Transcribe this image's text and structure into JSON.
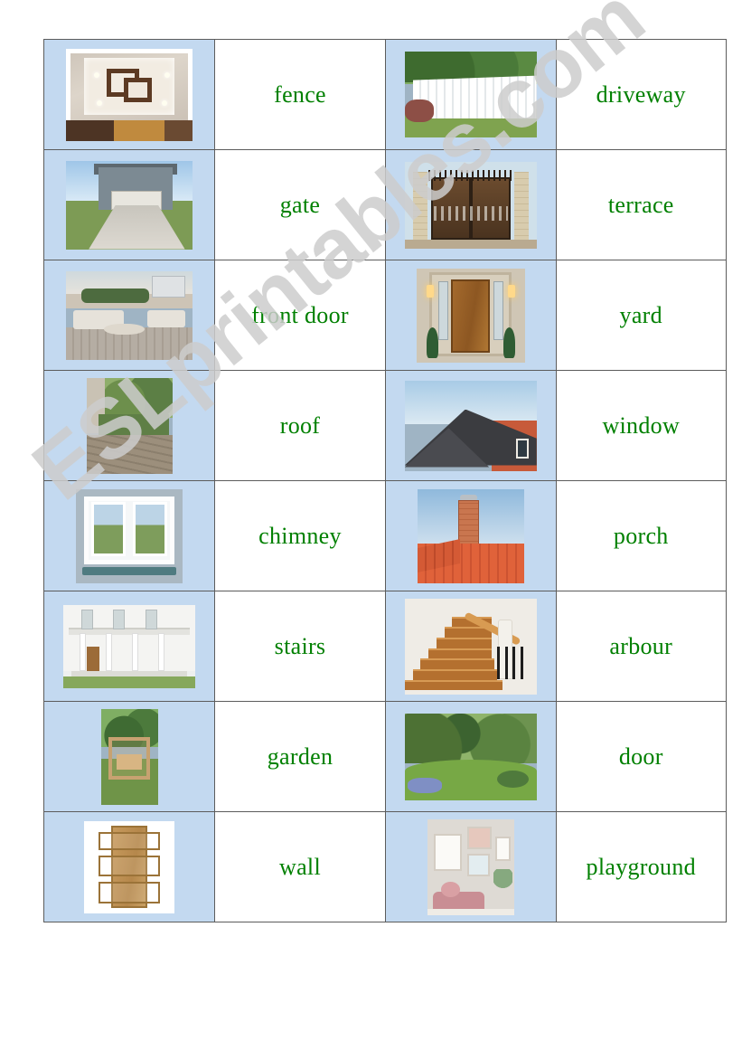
{
  "document": {
    "type": "esl-matching-worksheet",
    "topic": "Parts of a house and garden",
    "watermark": "ESLprintables.com"
  },
  "colors": {
    "word_green": "#008000",
    "picture_cell_background": "#c3d9f0",
    "word_cell_background": "#ffffff",
    "table_border": "#5c5c5c",
    "watermark_gray": "#cdcdcd"
  },
  "table": {
    "rows": 8,
    "columns": 4,
    "column_kinds": [
      "picture",
      "word",
      "picture",
      "word"
    ],
    "cells": [
      {
        "row": 1,
        "left_picture": "ceiling-design-interior",
        "left_word": "fence",
        "right_picture": "white-picket-fence",
        "right_word": "driveway"
      },
      {
        "row": 2,
        "left_picture": "house-with-driveway",
        "left_word": "gate",
        "right_picture": "wrought-iron-gate",
        "right_word": "terrace"
      },
      {
        "row": 3,
        "left_picture": "outdoor-terrace-lounge",
        "left_word": "front door",
        "right_picture": "wooden-front-door-with-lamps",
        "right_word": "yard"
      },
      {
        "row": 4,
        "left_picture": "garden-patio-deck",
        "left_word": "roof",
        "right_picture": "tiled-house-roof",
        "right_word": "window"
      },
      {
        "row": 5,
        "left_picture": "open-white-window",
        "left_word": "chimney",
        "right_picture": "brick-chimney-on-tiled-roof",
        "right_word": "porch"
      },
      {
        "row": 6,
        "left_picture": "white-house-with-porch",
        "left_word": "stairs",
        "right_picture": "wooden-indoor-staircase",
        "right_word": "arbour"
      },
      {
        "row": 7,
        "left_picture": "garden-arbour-swing",
        "left_word": "garden",
        "right_picture": "landscaped-garden-lawn",
        "right_word": "door"
      },
      {
        "row": 8,
        "left_picture": "wooden-interior-door",
        "left_word": "wall",
        "right_picture": "wall-with-picture-frames",
        "right_word": "playground"
      }
    ]
  }
}
